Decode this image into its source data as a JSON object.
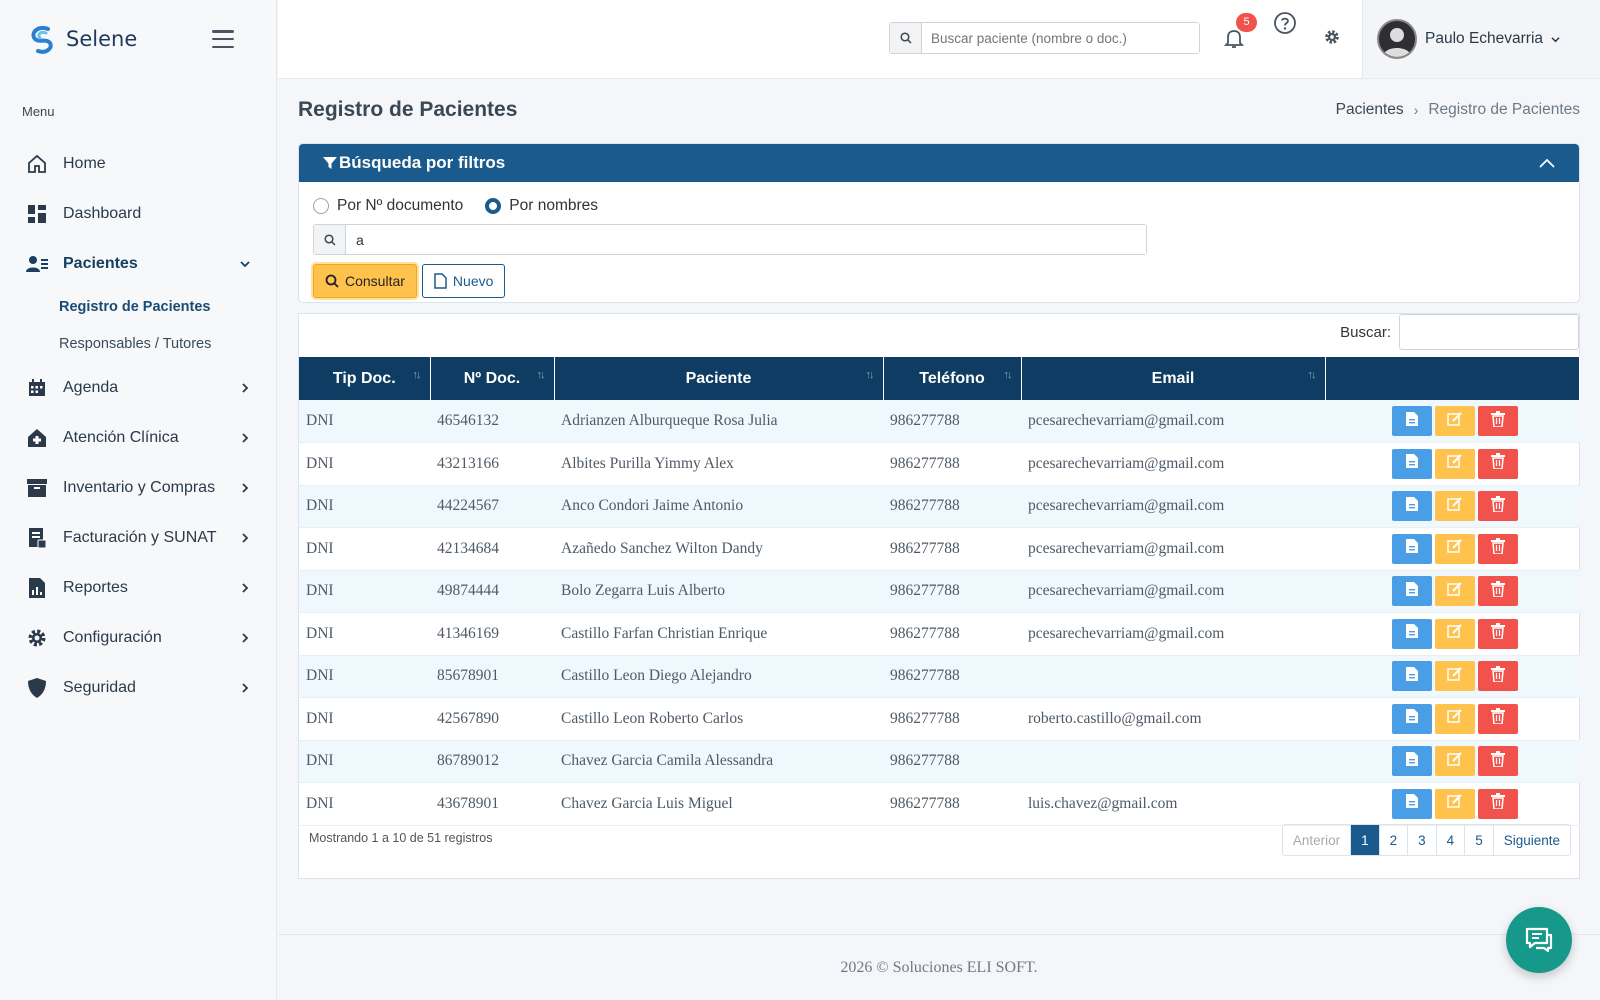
{
  "app": {
    "name": "Selene"
  },
  "sidebar": {
    "menu_label": "Menu",
    "items": [
      {
        "label": "Home",
        "icon": "home-icon"
      },
      {
        "label": "Dashboard",
        "icon": "dashboard-icon"
      },
      {
        "label": "Pacientes",
        "icon": "users-icon"
      },
      {
        "label": "Agenda",
        "icon": "calendar-icon"
      },
      {
        "label": "Atención Clínica",
        "icon": "clinic-icon"
      },
      {
        "label": "Inventario y Compras",
        "icon": "archive-icon"
      },
      {
        "label": "Facturación y SUNAT",
        "icon": "invoice-icon"
      },
      {
        "label": "Reportes",
        "icon": "report-icon"
      },
      {
        "label": "Configuración",
        "icon": "gear-icon"
      },
      {
        "label": "Seguridad",
        "icon": "shield-icon"
      }
    ],
    "pacientes_sub": [
      "Registro de Pacientes",
      "Responsables / Tutores"
    ]
  },
  "topbar": {
    "search_placeholder": "Buscar paciente (nombre o doc.)",
    "notif_count": "5",
    "user_name": "Paulo Echevarria"
  },
  "page": {
    "title": "Registro de Pacientes",
    "breadcrumb": [
      "Pacientes",
      "Registro de Pacientes"
    ]
  },
  "filter": {
    "title": "Búsqueda por filtros",
    "radio_doc": "Por Nº documento",
    "radio_names": "Por nombres",
    "selected": "names",
    "value": "a",
    "btn_consultar": "Consultar",
    "btn_nuevo": "Nuevo"
  },
  "table": {
    "search_label": "Buscar:",
    "columns": [
      "Tip Doc.",
      "Nº Doc.",
      "Paciente",
      "Teléfono",
      "Email"
    ],
    "rows": [
      [
        "DNI",
        "46546132",
        "Adrianzen Alburqueque Rosa Julia",
        "986277788",
        "pcesarechevarriam@gmail.com"
      ],
      [
        "DNI",
        "43213166",
        "Albites Purilla Yimmy Alex",
        "986277788",
        "pcesarechevarriam@gmail.com"
      ],
      [
        "DNI",
        "44224567",
        "Anco Condori Jaime Antonio",
        "986277788",
        "pcesarechevarriam@gmail.com"
      ],
      [
        "DNI",
        "42134684",
        "Azañedo Sanchez Wilton Dandy",
        "986277788",
        "pcesarechevarriam@gmail.com"
      ],
      [
        "DNI",
        "49874444",
        "Bolo Zegarra Luis Alberto",
        "986277788",
        "pcesarechevarriam@gmail.com"
      ],
      [
        "DNI",
        "41346169",
        "Castillo Farfan Christian Enrique",
        "986277788",
        "pcesarechevarriam@gmail.com"
      ],
      [
        "DNI",
        "85678901",
        "Castillo Leon Diego Alejandro",
        "986277788",
        ""
      ],
      [
        "DNI",
        "42567890",
        "Castillo Leon Roberto Carlos",
        "986277788",
        "roberto.castillo@gmail.com"
      ],
      [
        "DNI",
        "86789012",
        "Chavez Garcia Camila Alessandra",
        "986277788",
        ""
      ],
      [
        "DNI",
        "43678901",
        "Chavez Garcia Luis Miguel",
        "986277788",
        "luis.chavez@gmail.com"
      ]
    ],
    "info": "Mostrando 1 a 10 de 51 registros",
    "pager": [
      "Anterior",
      "1",
      "2",
      "3",
      "4",
      "5",
      "Siguiente"
    ],
    "current_page": "1"
  },
  "footer": {
    "text": "2026 © Soluciones ELI SOFT."
  },
  "colors": {
    "primary": "#1b5a8c",
    "header_dark": "#0f3c62",
    "warning": "#ffc24d",
    "danger": "#f1524b",
    "info": "#4a9ee6",
    "chat": "#16998a"
  }
}
